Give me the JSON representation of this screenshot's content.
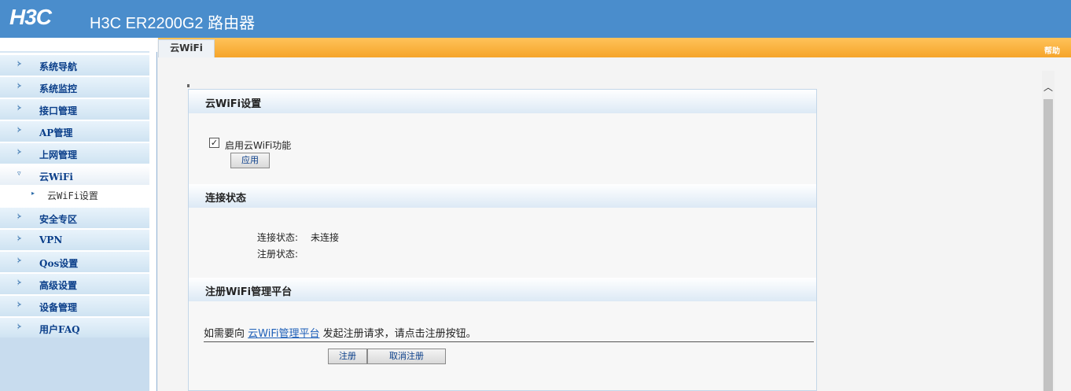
{
  "header": {
    "logo": "H3C",
    "title": "H3C ER2200G2 路由器"
  },
  "sidebar": {
    "items": [
      {
        "label": "系统导航"
      },
      {
        "label": "系统监控"
      },
      {
        "label": "接口管理"
      },
      {
        "label": "AP管理"
      },
      {
        "label": "上网管理"
      },
      {
        "label": "云WiFi"
      },
      {
        "label": "安全专区"
      },
      {
        "label": "VPN"
      },
      {
        "label": "Qos设置"
      },
      {
        "label": "高级设置"
      },
      {
        "label": "设备管理"
      },
      {
        "label": "用户FAQ"
      }
    ],
    "sub_items": [
      {
        "label": "云WiFi设置"
      }
    ]
  },
  "tabbar": {
    "active_tab": "云WiFi",
    "help": "帮助"
  },
  "settings": {
    "title": "云WiFi设置",
    "enable_label": "启用云WiFi功能",
    "enable_checked": true,
    "apply_button": "应用"
  },
  "connection": {
    "title": "连接状态",
    "conn_label": "连接状态:",
    "conn_value": "未连接",
    "reg_label": "注册状态:",
    "reg_value": ""
  },
  "register": {
    "title": "注册WiFi管理平台",
    "text_before": "如需要向 ",
    "link": "云WiFi管理平台",
    "text_after": " 发起注册请求，请点击注册按钮。",
    "register_button": "注册",
    "unregister_button": "取消注册"
  }
}
